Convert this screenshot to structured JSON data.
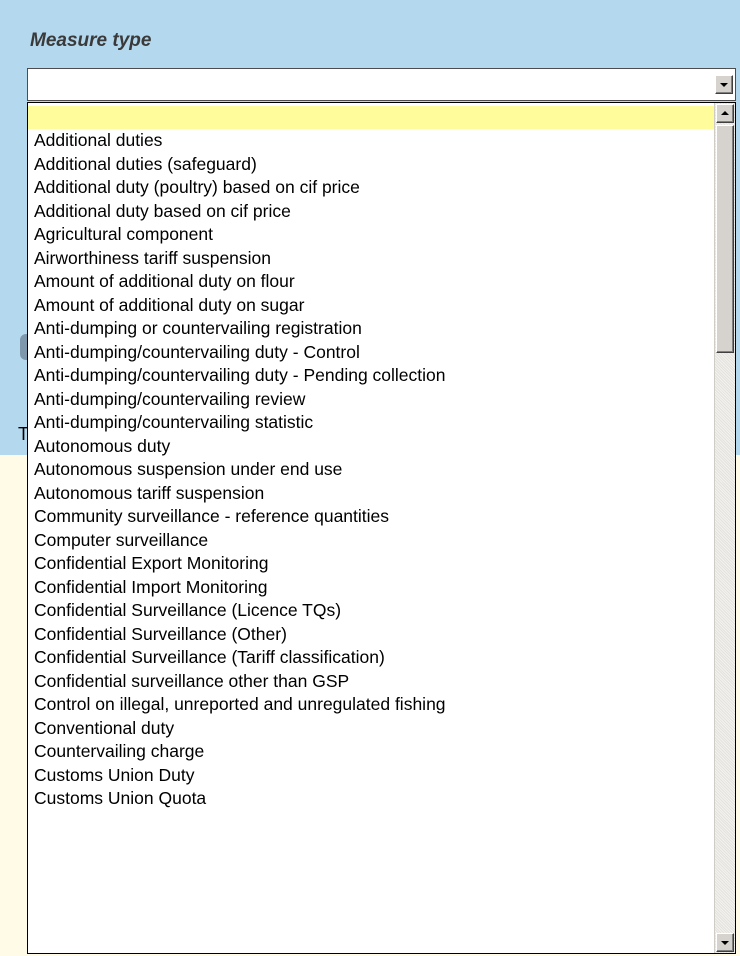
{
  "field": {
    "label": "Measure type",
    "value": ""
  },
  "background": {
    "partial_text": "T"
  },
  "dropdown": {
    "highlighted_index": 0,
    "options": [
      "",
      "Additional duties",
      "Additional duties (safeguard)",
      "Additional duty (poultry) based on cif price",
      "Additional duty based on cif price",
      "Agricultural component",
      "Airworthiness tariff suspension",
      "Amount of additional duty on flour",
      "Amount of additional duty on sugar",
      "Anti-dumping or countervailing registration",
      "Anti-dumping/countervailing duty - Control",
      "Anti-dumping/countervailing duty - Pending collection",
      "Anti-dumping/countervailing review",
      "Anti-dumping/countervailing statistic",
      "Autonomous duty",
      "Autonomous suspension under end use",
      "Autonomous tariff suspension",
      "Community surveillance - reference quantities",
      "Computer surveillance",
      "Confidential Export Monitoring",
      "Confidential Import Monitoring",
      "Confidential Surveillance (Licence TQs)",
      "Confidential Surveillance (Other)",
      "Confidential Surveillance (Tariff classification)",
      "Confidential surveillance other than GSP",
      "Control on illegal, unreported and unregulated fishing",
      "Conventional duty",
      "Countervailing charge",
      "Customs Union Duty",
      "Customs Union Quota"
    ]
  },
  "icons": {
    "combo_arrow": "chevron-down-icon",
    "scroll_up": "scroll-up-arrow-icon",
    "scroll_down": "scroll-down-arrow-icon"
  },
  "colors": {
    "panel_bg": "#b4d8ee",
    "highlight": "#fffd9b",
    "page_bg": "#fffbe6"
  }
}
